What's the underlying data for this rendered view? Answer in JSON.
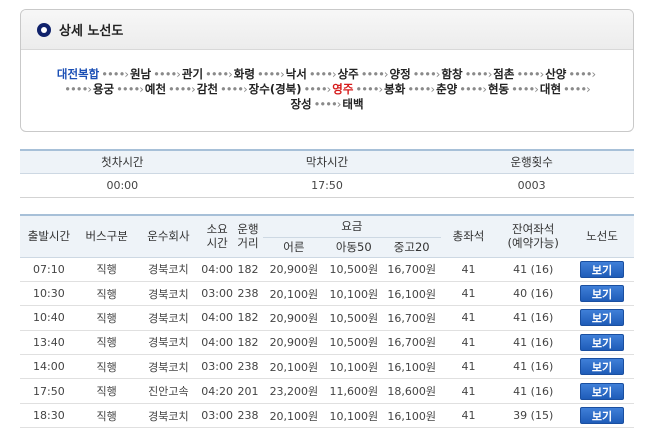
{
  "route": {
    "title": "상세 노선도",
    "separator": "••••›",
    "lines": [
      [
        {
          "name": "대전복합",
          "type": "origin"
        },
        {
          "name": "원남",
          "type": "normal"
        },
        {
          "name": "관기",
          "type": "normal"
        },
        {
          "name": "화령",
          "type": "normal"
        },
        {
          "name": "낙서",
          "type": "normal"
        },
        {
          "name": "상주",
          "type": "normal"
        },
        {
          "name": "양정",
          "type": "normal"
        },
        {
          "name": "함창",
          "type": "normal"
        },
        {
          "name": "점촌",
          "type": "normal"
        },
        {
          "name": "산양",
          "type": "normal",
          "trail": true
        }
      ],
      [
        {
          "name": "용궁",
          "type": "normal",
          "lead": true
        },
        {
          "name": "예천",
          "type": "normal"
        },
        {
          "name": "감천",
          "type": "normal"
        },
        {
          "name": "장수(경북)",
          "type": "normal"
        },
        {
          "name": "영주",
          "type": "current"
        },
        {
          "name": "봉화",
          "type": "normal"
        },
        {
          "name": "춘양",
          "type": "normal"
        },
        {
          "name": "현동",
          "type": "normal"
        },
        {
          "name": "대현",
          "type": "normal",
          "trail": true
        }
      ],
      [
        {
          "name": "장성",
          "type": "normal"
        },
        {
          "name": "태백",
          "type": "normal"
        }
      ]
    ]
  },
  "summary": {
    "headers": [
      "첫차시간",
      "막차시간",
      "운행횟수"
    ],
    "values": [
      "00:00",
      "17:50",
      "0003"
    ]
  },
  "schedule": {
    "headers": {
      "depart": "출발시간",
      "bus_type": "버스구분",
      "company": "운수회사",
      "duration_1": "소요",
      "duration_2": "시간",
      "distance_1": "운행",
      "distance_2": "거리",
      "fare": "요금",
      "fare_adult": "어른",
      "fare_child": "아동50",
      "fare_student": "중고20",
      "seats": "총좌석",
      "remaining_1": "잔여좌석",
      "remaining_2": "(예약가능)",
      "route_map": "노선도"
    },
    "button_label": "보기",
    "rows": [
      [
        "07:10",
        "직행",
        "경북코치",
        "04:00",
        "182",
        "20,900원",
        "10,500원",
        "16,700원",
        "41",
        "41 (16)"
      ],
      [
        "10:30",
        "직행",
        "경북코치",
        "03:00",
        "238",
        "20,100원",
        "10,100원",
        "16,100원",
        "41",
        "40 (16)"
      ],
      [
        "10:40",
        "직행",
        "경북코치",
        "04:00",
        "182",
        "20,900원",
        "10,500원",
        "16,700원",
        "41",
        "41 (16)"
      ],
      [
        "13:40",
        "직행",
        "경북코치",
        "04:00",
        "182",
        "20,900원",
        "10,500원",
        "16,700원",
        "41",
        "41 (16)"
      ],
      [
        "14:00",
        "직행",
        "경북코치",
        "03:00",
        "238",
        "20,100원",
        "10,100원",
        "16,100원",
        "41",
        "41 (16)"
      ],
      [
        "17:50",
        "직행",
        "진안고속",
        "04:20",
        "201",
        "23,200원",
        "11,600원",
        "18,600원",
        "41",
        "41 (16)"
      ],
      [
        "18:30",
        "직행",
        "경북코치",
        "03:00",
        "238",
        "20,100원",
        "10,100원",
        "16,100원",
        "41",
        "39 (15)"
      ]
    ]
  }
}
